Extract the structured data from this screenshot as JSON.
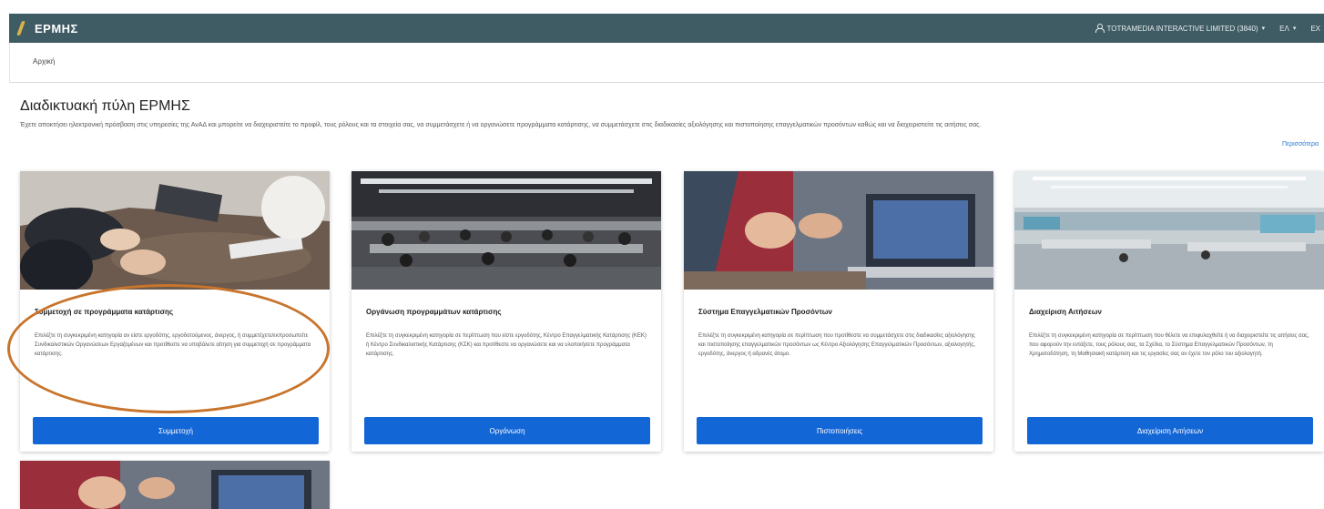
{
  "app": {
    "name": "ΕΡΜΗΣ"
  },
  "header": {
    "organization": "TOTRAMEDIA INTERACTIVE LIMITED (3840)",
    "language": "EΛ",
    "extra": "EX"
  },
  "breadcrumb": {
    "home": "Αρχική"
  },
  "page": {
    "title": "Διαδικτυακή πύλη ΕΡΜΗΣ",
    "intro": "Έχετε αποκτήσει ηλεκτρονική πρόσβαση στις υπηρεσίες της ΑνΑΔ και μπορείτε να διαχειριστείτε το προφίλ, τους ρόλους και τα στοιχεία σας, να συμμετάσχετε ή να οργανώσετε προγράμματα κατάρτισης, να συμμετάσχετε στις διαδικασίες αξιολόγησης και πιστοποίησης επαγγελματικών προσόντων καθώς και να διαχειριστείτε τις αιτήσεις σας.",
    "more_link": "Περισσότερα"
  },
  "cards": [
    {
      "title": "Συμμετοχή σε προγράμματα κατάρτισης",
      "description": "Επιλέξτε τη συγκεκριμένη κατηγορία αν είστε εργοδότης, εργοδοτούμενος, άνεργος, ή συμμετέχετε/εκπροσωπείτε Συνδικαλιστικών Οργανώσεων Εργαζομένων και προτίθεστε να υποβάλετε αίτηση για συμμετοχή σε προγράμματα κατάρτισης.",
      "button": "Συμμετοχή"
    },
    {
      "title": "Οργάνωση προγραμμάτων κατάρτισης",
      "description": "Επιλέξτε τη συγκεκριμένη κατηγορία σε περίπτωση που είστε εργοδότης, Κέντρο Επαγγελματικής Κατάρτισης (ΚΕΚ) ή Κέντρο Συνδικαλιστικής Κατάρτισης (ΚΣΚ) και προτίθεστε να οργανώσετε και να υλοποιήσετε προγράμματα κατάρτισης.",
      "button": "Οργάνωση"
    },
    {
      "title": "Σύστημα Επαγγελματικών Προσόντων",
      "description": "Επιλέξτε τη συγκεκριμένη κατηγορία σε περίπτωση που προτίθεστε να συμμετάσχετε στις διαδικασίες αξιολόγησης και πιστοποίησης επαγγελματικών προσόντων ως Κέντρο Αξιολόγησης Επαγγελματικών Προσόντων, αξιολογητής, εργοδότης, άνεργος ή αδρανές άτομο.",
      "button": "Πιστοποιήσεις"
    },
    {
      "title": "Διαχείριση Αιτήσεων",
      "description": "Επιλέξτε τη συγκεκριμένη κατηγορία σε περίπτωση που θέλετε να επιφυλαχθείτε ή να διαχειριστείτε τις αιτήσεις σας, που αφορούν την εντάξετε, τους ρόλους σας, τα Σχέδια, το Σύστημα Επαγγελματικών Προσόντων, τη Χρηματοδότηση, τη Μαθησιακή κατάρτιση και τις εργασίες σας αν έχετε τον ρόλο του αξιολογητή.",
      "button": "Διαχείριση Αιτήσεων"
    }
  ],
  "colors": {
    "header_bg": "#3f5b64",
    "button_bg": "#1366d6",
    "highlight": "#c8742c",
    "link": "#2b7bd0"
  }
}
